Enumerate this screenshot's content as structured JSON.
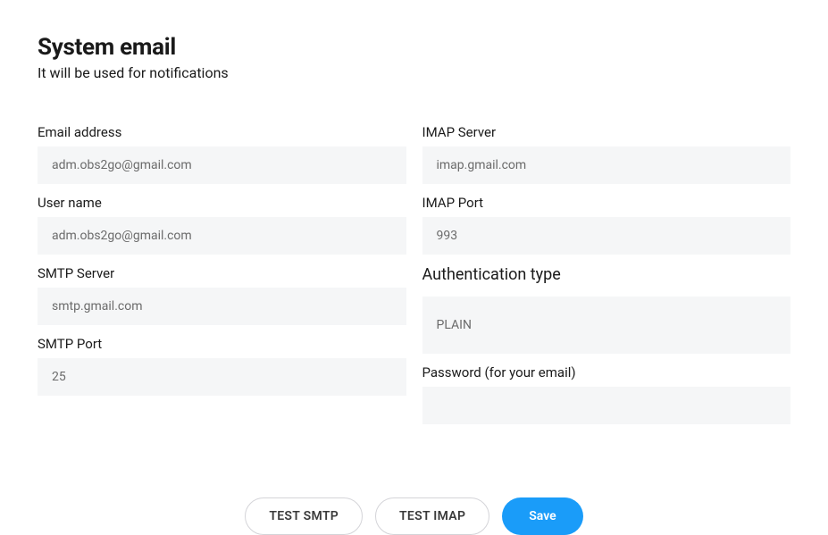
{
  "header": {
    "title": "System email",
    "subtitle": "It will be used for notifications"
  },
  "left": {
    "email_label": "Email address",
    "email_value": "adm.obs2go@gmail.com",
    "username_label": "User name",
    "username_value": "adm.obs2go@gmail.com",
    "smtp_server_label": "SMTP Server",
    "smtp_server_value": "smtp.gmail.com",
    "smtp_port_label": "SMTP Port",
    "smtp_port_value": "25"
  },
  "right": {
    "imap_server_label": "IMAP Server",
    "imap_server_value": "imap.gmail.com",
    "imap_port_label": "IMAP Port",
    "imap_port_value": "993",
    "auth_type_label": "Authentication type",
    "auth_type_value": "PLAIN",
    "password_label": "Password (for your email)",
    "password_value": ""
  },
  "actions": {
    "test_smtp": "TEST SMTP",
    "test_imap": "TEST IMAP",
    "save": "Save"
  }
}
